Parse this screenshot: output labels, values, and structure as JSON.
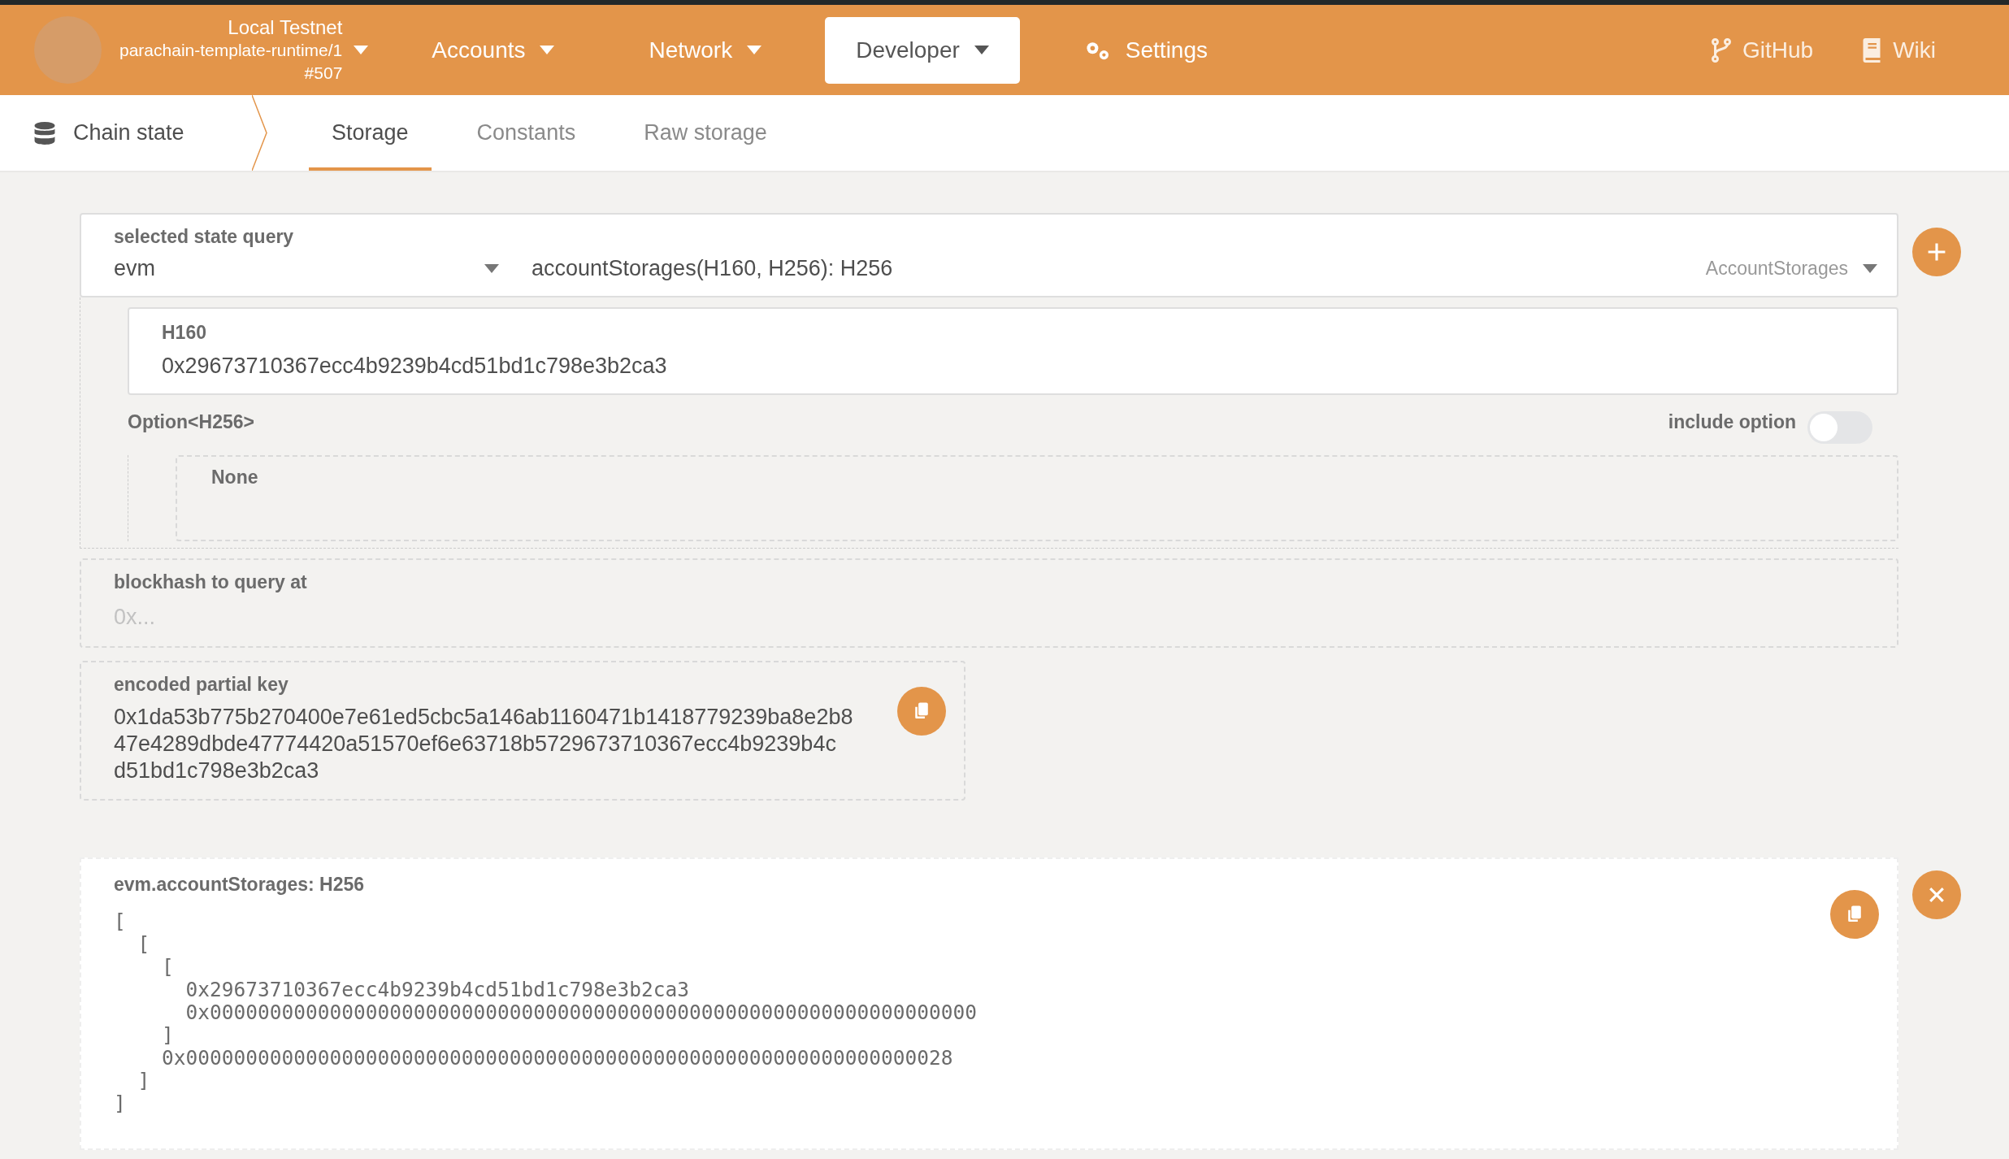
{
  "header": {
    "chain_name": "Local Testnet",
    "runtime": "parachain-template-runtime/1",
    "block": "#507",
    "menus": [
      {
        "label": "Accounts",
        "kind": "dropdown",
        "selected": false
      },
      {
        "label": "Network",
        "kind": "dropdown",
        "selected": false
      },
      {
        "label": "Developer",
        "kind": "dropdown",
        "selected": true
      },
      {
        "label": "Settings",
        "kind": "settings",
        "selected": false
      }
    ],
    "links": [
      {
        "label": "GitHub",
        "kind": "github"
      },
      {
        "label": "Wiki",
        "kind": "wiki"
      }
    ]
  },
  "subnav": {
    "section": "Chain state",
    "tabs": [
      {
        "label": "Storage",
        "selected": true
      },
      {
        "label": "Constants",
        "selected": false
      },
      {
        "label": "Raw storage",
        "selected": false
      }
    ]
  },
  "query": {
    "label": "selected state query",
    "module": "evm",
    "method": "accountStorages(H160, H256): H256",
    "method_name": "AccountStorages"
  },
  "params": [
    {
      "label": "H160",
      "value": "0x29673710367ecc4b9239b4cd51bd1c798e3b2ca3"
    }
  ],
  "option": {
    "label": "Option<H256>",
    "include_label": "include option",
    "include": false,
    "value": "None"
  },
  "blockhash": {
    "label": "blockhash to query at",
    "placeholder": "0x..."
  },
  "encoded_key": {
    "label": "encoded partial key",
    "lines": [
      "0x1da53b775b270400e7e61ed5cbc5a146ab1160471b1418779239ba8e2b8",
      "47e4289dbde47774420a51570ef6e63718b5729673710367ecc4b9239b4c",
      "d51bd1c798e3b2ca3"
    ]
  },
  "result": {
    "title": "evm.accountStorages: H256",
    "lines": [
      "[",
      "  [",
      "    [",
      "      0x29673710367ecc4b9239b4cd51bd1c798e3b2ca3",
      "      0x0000000000000000000000000000000000000000000000000000000000000000",
      "    ]",
      "    0x0000000000000000000000000000000000000000000000000000000000000028",
      "  ]",
      "]"
    ]
  }
}
